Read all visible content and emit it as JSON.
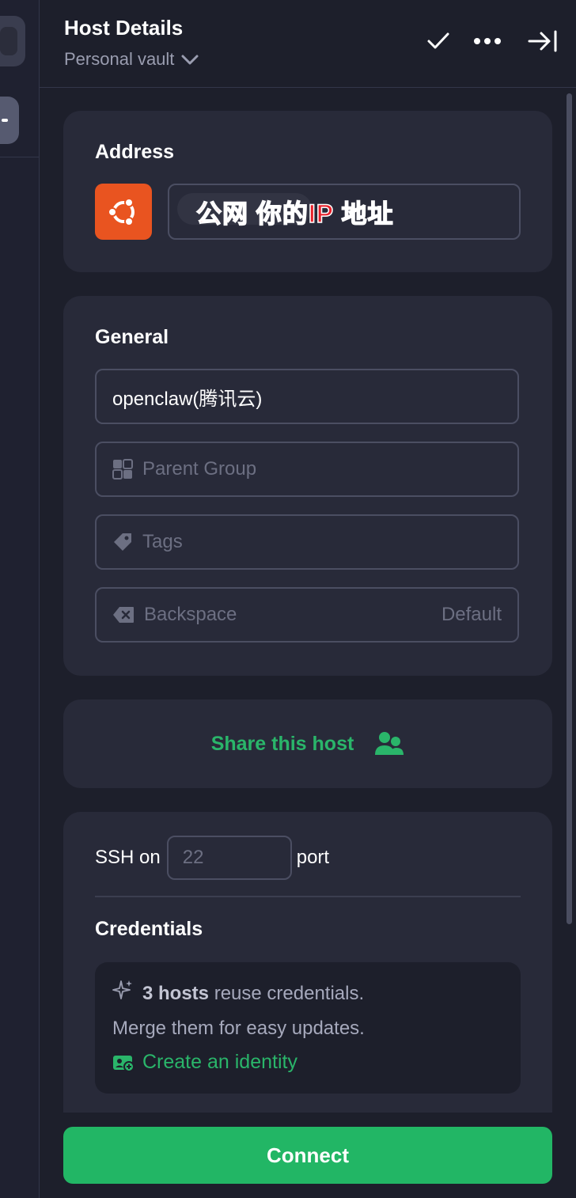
{
  "header": {
    "title": "Host Details",
    "vault": "Personal vault",
    "icons": [
      "checkmark-icon",
      "more-dots-icon",
      "collapse-panel-icon"
    ]
  },
  "address": {
    "section_title": "Address",
    "os_icon": "ubuntu-icon",
    "value": "公网 你的IP 地址"
  },
  "general": {
    "section_title": "General",
    "label_value": "openclaw(腾讯云)",
    "parent_group_placeholder": "Parent Group",
    "tags_placeholder": "Tags",
    "backspace_label": "Backspace",
    "backspace_value": "Default"
  },
  "share": {
    "label": "Share this host"
  },
  "ssh": {
    "prefix": "SSH on",
    "port_placeholder": "22",
    "suffix": "port",
    "credentials_title": "Credentials",
    "info_bold": "3 hosts",
    "info_rest": " reuse credentials.",
    "info_line2": "Merge them for easy updates.",
    "identity_link": "Create an identity"
  },
  "connect_label": "Connect",
  "colors": {
    "background": "#1d1f2b",
    "card": "#282a39",
    "accent_green": "#22b665",
    "link_green": "#2ab56a",
    "ubuntu_orange": "#e95420",
    "watermark_red": "#e8202a"
  }
}
